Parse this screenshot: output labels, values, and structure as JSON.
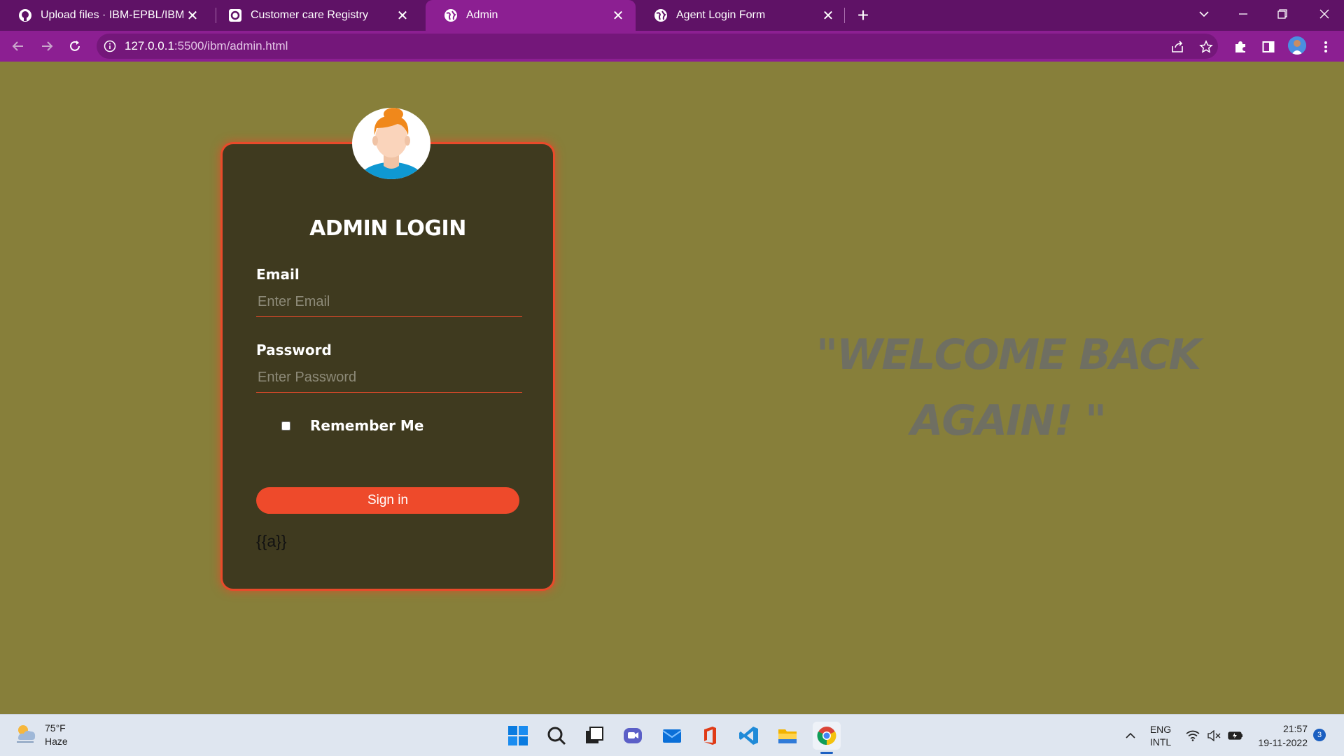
{
  "browser": {
    "tabs": [
      {
        "title": "Upload files · IBM-EPBL/IBM-Proj",
        "icon": "github-icon",
        "active": false
      },
      {
        "title": "Customer care Registry",
        "icon": "page-icon",
        "active": false
      },
      {
        "title": "Admin",
        "icon": "globe-icon",
        "active": true
      },
      {
        "title": "Agent Login Form",
        "icon": "globe-icon",
        "active": false
      }
    ],
    "url_host": "127.0.0.1",
    "url_rest": ":5500/ibm/admin.html"
  },
  "login": {
    "title": "ADMIN LOGIN",
    "email_label": "Email",
    "email_placeholder": "Enter Email",
    "email_value": "",
    "password_label": "Password",
    "password_placeholder": "Enter Password",
    "password_value": "",
    "remember_label": "Remember Me",
    "remember_checked": false,
    "signin_label": "Sign in",
    "template_text": "{{a}}"
  },
  "welcome": {
    "line1": "\"WELCOME BACK",
    "line2": "AGAIN! \""
  },
  "taskbar": {
    "weather_temp": "75°F",
    "weather_desc": "Haze",
    "lang_line1": "ENG",
    "lang_line2": "INTL",
    "time": "21:57",
    "date": "19-11-2022",
    "notification_count": "3"
  },
  "colors": {
    "page_bg": "#877f3a",
    "card_bg": "#3f3a1f",
    "accent": "#e94a2a",
    "tab_bar": "#5f1266",
    "toolbar": "#8c1f92"
  }
}
